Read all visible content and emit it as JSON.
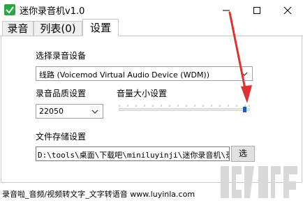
{
  "window": {
    "title": "迷你录音机v1.0",
    "accent_color": "#2aa845"
  },
  "tabs": [
    {
      "label": "录音",
      "active": false
    },
    {
      "label": "列表(0)",
      "active": false
    },
    {
      "label": "设置",
      "active": true
    }
  ],
  "settings": {
    "device_label": "选择录音设备",
    "device_value": "线路 (Voicemod Virtual Audio Device (WDM))",
    "quality_label": "录音品质设置",
    "quality_value": "22050",
    "volume_label": "音量大小设置",
    "volume_level": 1.0,
    "storage_label": "文件存储设置",
    "storage_path": "D:\\tools\\桌面\\下载吧\\miniluyinji\\迷你录音机\\录音",
    "browse_label": "选"
  },
  "footer": {
    "text": "录音啦_音频/视频转文字_文字转语音 www.luyinla.com"
  },
  "annotation": {
    "arrow_color": "#e03030"
  }
}
